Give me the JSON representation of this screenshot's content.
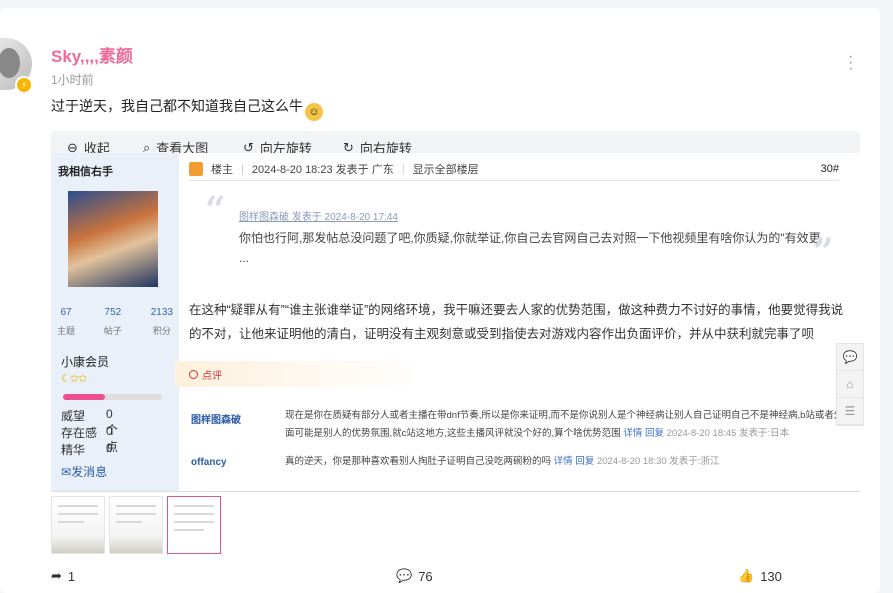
{
  "post": {
    "username": "Sky,,,,素颜",
    "time": "1小时前",
    "text": "过于逆天，我自己都不知道我自己这么牛"
  },
  "toolbar": {
    "collapse": "收起",
    "view_large": "查看大图",
    "rotate_left": "向左旋转",
    "rotate_right": "向右旋转"
  },
  "image": {
    "side": {
      "username": "我相信右手",
      "stats": [
        {
          "value": "67",
          "label": "主题"
        },
        {
          "value": "752",
          "label": "帖子"
        },
        {
          "value": "2133",
          "label": "积分"
        }
      ],
      "level": "小康会员",
      "stars": "☾✩✩",
      "level_progress": 0.42,
      "prestige_label": "威望",
      "prestige_value": "0 个",
      "presence_label": "存在感",
      "presence_value": "0 点",
      "essence_label": "精华",
      "essence_value": "0",
      "send_msg": "发消息"
    },
    "floor": {
      "role": "楼主",
      "time": "2024-8-20 18:23 发表于 广东",
      "show_all": "显示全部楼层",
      "number": "30#"
    },
    "quote": {
      "source": "图样图森破 发表于 2024-8-20 17:44",
      "text": "你怕也行阿,那发帖总没问题了吧,你质疑,你就举证,你自己去官网自己去对照一下他视频里有啥你认为的\"有效更 ..."
    },
    "body": "在这种“疑罪从有”“谁主张谁举证”的网络环境，我干嘛还要去人家的优势范围，做这种费力不讨好的事情，他要觉得我说的不对，让他来证明他的清白，证明没有主观刻意或受到指使去对游戏内容作出负面评价，并从中获利就完事了呗",
    "comment_label": "点评",
    "comments": [
      {
        "name": "图样图森破",
        "text": "现在是你在质疑有部分人或者主播在带dnf节奏,所以是你来证明,而不是你说别人是个神经病让别人自己证明自己不是神经病,b站或者外面可能是别人的优势氛围,就c站这地方,这些主播风评就没个好的,算个啥优势范围",
        "links": "详情 回复",
        "meta": "2024-8-20 18:45 发表于:日本"
      },
      {
        "name": "offancy",
        "text": "真的逆天，你是那种喜欢看别人掏肚子证明自己没吃两碗粉的吗",
        "links": "详情 回复",
        "meta": "2024-8-20 18:30 发表于:浙江"
      }
    ]
  },
  "footer": {
    "share": "1",
    "comments": "76",
    "likes": "130"
  },
  "colors": {
    "username": "#f06a9a",
    "link": "#2a5da8",
    "level_bar": "#ec4e8f"
  }
}
